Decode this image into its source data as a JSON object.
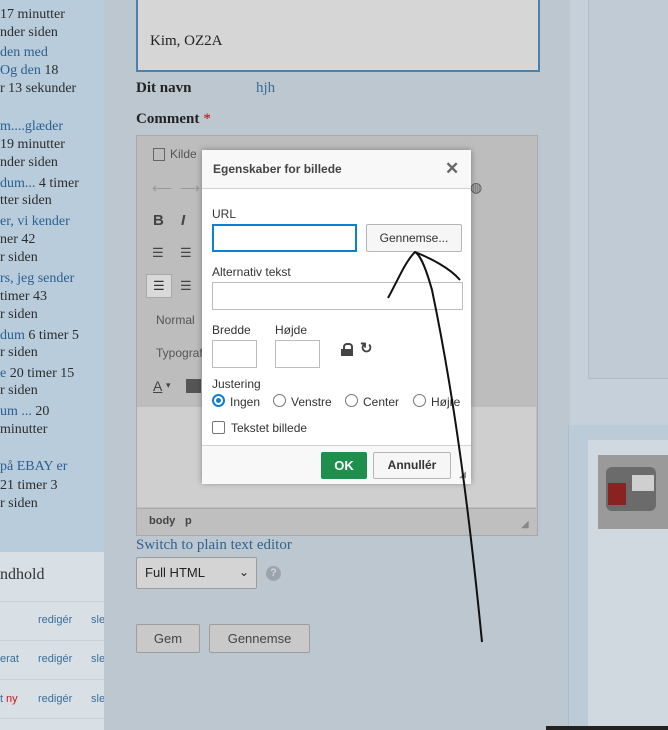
{
  "left": {
    "items": [
      {
        "parts": [
          {
            "t": "17 minutter",
            "c": "txt"
          }
        ]
      },
      {
        "parts": [
          {
            "t": "nder siden",
            "c": "txt"
          }
        ]
      },
      {
        "parts": [
          {
            "t": "den med",
            "c": "lnk"
          }
        ]
      },
      {
        "parts": [
          {
            "t": "Og den ",
            "c": "lnk"
          },
          {
            "t": "18",
            "c": "txt"
          }
        ]
      },
      {
        "parts": [
          {
            "t": "r 13 sekunder",
            "c": "txt"
          }
        ]
      },
      {
        "parts": [
          {
            "t": "m....glæder",
            "c": "lnk"
          }
        ]
      },
      {
        "parts": [
          {
            "t": "19 minutter",
            "c": "txt"
          }
        ]
      },
      {
        "parts": [
          {
            "t": "nder siden",
            "c": "txt"
          }
        ]
      },
      {
        "parts": [
          {
            "t": "dum... ",
            "c": "lnk"
          },
          {
            "t": "4 timer",
            "c": "txt"
          }
        ]
      },
      {
        "parts": [
          {
            "t": "tter siden",
            "c": "txt"
          }
        ]
      },
      {
        "parts": [
          {
            "t": "er, vi kender",
            "c": "lnk"
          }
        ]
      },
      {
        "parts": [
          {
            "t": "ner 42",
            "c": "txt"
          }
        ]
      },
      {
        "parts": [
          {
            "t": "r siden",
            "c": "txt"
          }
        ]
      },
      {
        "parts": [
          {
            "t": "rs, jeg sender",
            "c": "lnk"
          }
        ]
      },
      {
        "parts": [
          {
            "t": "timer 43",
            "c": "txt"
          }
        ]
      },
      {
        "parts": [
          {
            "t": "r siden",
            "c": "txt"
          }
        ]
      },
      {
        "parts": [
          {
            "t": "dum ",
            "c": "lnk"
          },
          {
            "t": "6 timer 5",
            "c": "txt"
          }
        ]
      },
      {
        "parts": [
          {
            "t": "r siden",
            "c": "txt"
          }
        ]
      },
      {
        "parts": [
          {
            "t": "e ",
            "c": "lnk"
          },
          {
            "t": "20 timer 15",
            "c": "txt"
          }
        ]
      },
      {
        "parts": [
          {
            "t": "r siden",
            "c": "txt"
          }
        ]
      },
      {
        "parts": [
          {
            "t": "um ... ",
            "c": "lnk"
          },
          {
            "t": "20",
            "c": "txt"
          }
        ]
      },
      {
        "parts": [
          {
            "t": "minutter",
            "c": "txt"
          }
        ]
      },
      {
        "parts": [
          {
            "t": "på EBAY er",
            "c": "lnk"
          }
        ]
      },
      {
        "parts": [
          {
            "t": "21 timer 3",
            "c": "txt"
          }
        ]
      },
      {
        "parts": [
          {
            "t": "r siden",
            "c": "txt"
          }
        ]
      }
    ],
    "box_title": "ndhold",
    "rows": [
      {
        "c1": "",
        "c2": "redigér",
        "c3": "slet"
      },
      {
        "c1": "erat",
        "c2": "redigér",
        "c3": "slet"
      },
      {
        "c1": "t",
        "badge": "ny",
        "c2": "redigér",
        "c3": "slet"
      }
    ]
  },
  "form": {
    "signature": "Kim, OZ2A",
    "name_label": "Dit navn",
    "name_value": "hjh",
    "comment_label": "Comment",
    "required_mark": "*",
    "toolbar": {
      "source": "Kilde",
      "bold": "B",
      "italic": "I",
      "format": "Normal",
      "font": "Typograf",
      "text_color": "A"
    },
    "status_path": [
      "body",
      "p"
    ],
    "switch_link": "Switch to plain text editor",
    "format_select": "Full HTML",
    "save_button": "Gem",
    "preview_button": "Gennemse"
  },
  "dialog": {
    "title": "Egenskaber for billede",
    "url_label": "URL",
    "url_value": "",
    "browse_button": "Gennemse...",
    "alt_label": "Alternativ tekst",
    "alt_value": "",
    "width_label": "Bredde",
    "height_label": "Højde",
    "alignment_label": "Justering",
    "align_options": [
      "Ingen",
      "Venstre",
      "Center",
      "Højre"
    ],
    "align_selected": "Ingen",
    "caption_label": "Tekstet billede",
    "ok_button": "OK",
    "cancel_button": "Annullér"
  },
  "colors": {
    "accent": "#0f7fd1",
    "ok": "#1f8f4e",
    "link": "#2a5f8f"
  }
}
